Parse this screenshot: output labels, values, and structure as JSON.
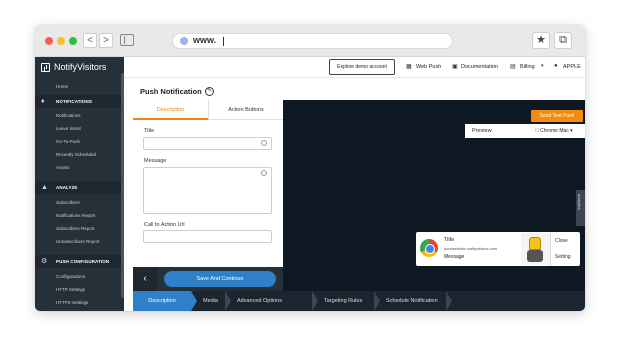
{
  "browser": {
    "url": "www.",
    "nav_back": "<",
    "nav_forward": ">",
    "star": "★",
    "copy": "⧉"
  },
  "sidebar": {
    "brand": "NotifyVisitors",
    "home": "Home",
    "sections": [
      {
        "label": "NOTIFICATIONS",
        "items": [
          "Notifications",
          "Leave Intent",
          "Go-To-Push",
          "Recently Scheduled",
          "Assets"
        ]
      },
      {
        "label": "ANALYZE",
        "items": [
          "Subscribers",
          "Notifications Report",
          "Subscribers Report",
          "Unsubscribers Report"
        ]
      },
      {
        "label": "PUSH CONFIGURATION",
        "items": [
          "Configurations",
          "HTTP Settings",
          "HTTPS Settings"
        ]
      }
    ]
  },
  "topbar": {
    "explore": "Explore demo account",
    "webpush": "Web Push",
    "documentation": "Documentation",
    "billing": "Billing",
    "user": "APPLE"
  },
  "page": {
    "title": "Push Notification"
  },
  "form": {
    "tabs": [
      "Description",
      "Action Buttons"
    ],
    "title_label": "Title",
    "message_label": "Message",
    "cta_label": "Call to Action Url",
    "back": "‹",
    "save": "Save And Continue"
  },
  "preview": {
    "send_test": "Send Test Push",
    "label": "Preview",
    "browser_select": "Chrome Mac",
    "side_tab": "Analytics",
    "notification": {
      "title": "Title",
      "site": "yourwebsite.notifyvisitors.com",
      "message": "Message",
      "actions": [
        "Close",
        "Setting"
      ]
    }
  },
  "steps": [
    "Description",
    "Media",
    "Advanced Options",
    "Targeting Rules",
    "Schedule Notification"
  ],
  "colors": {
    "accent_orange": "#f0870b",
    "primary_blue": "#2f80c8",
    "sidebar_dark": "#263039",
    "preview_dark": "#0f1923"
  }
}
